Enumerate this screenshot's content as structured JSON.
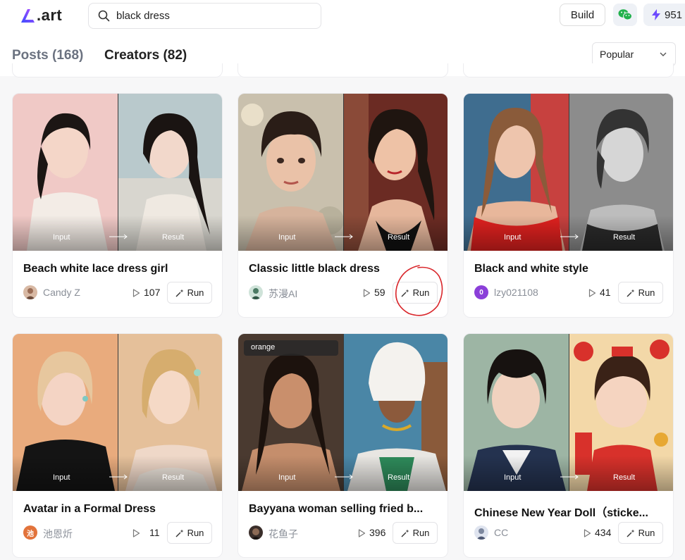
{
  "header": {
    "logo_text": ".art",
    "search_value": "black dress",
    "build_label": "Build",
    "credits": "951"
  },
  "tabs": {
    "posts_label": "Posts",
    "posts_count": "(168)",
    "creators_label": "Creators",
    "creators_count": "(82)",
    "sort_value": "Popular"
  },
  "labels": {
    "input": "Input",
    "result": "Result",
    "run": "Run"
  },
  "cards": [
    {
      "title": "Beach white lace dress girl",
      "author": "Candy Z",
      "runs": "107",
      "tag": ""
    },
    {
      "title": "Classic little black dress",
      "author": "苏漫AI",
      "runs": "59",
      "tag": ""
    },
    {
      "title": "Black and white style",
      "author": "lzy021108",
      "avatar_letter": "0",
      "runs": "41",
      "tag": ""
    },
    {
      "title": "Avatar in a Formal Dress",
      "author": "池恩炘",
      "avatar_letter": "池",
      "runs": "11",
      "tag": ""
    },
    {
      "title": "Bayyana woman selling fried b...",
      "author": "花鱼子",
      "runs": "396",
      "tag": "orange"
    },
    {
      "title": "Chinese New Year Doll（sticke...",
      "author": "CC",
      "runs": "434",
      "tag": ""
    }
  ],
  "colors": {
    "accent": "#6d4aff",
    "avatar_purple": "#8b3fd9",
    "avatar_orange": "#e2733b",
    "annotation_red": "#d9262b"
  }
}
